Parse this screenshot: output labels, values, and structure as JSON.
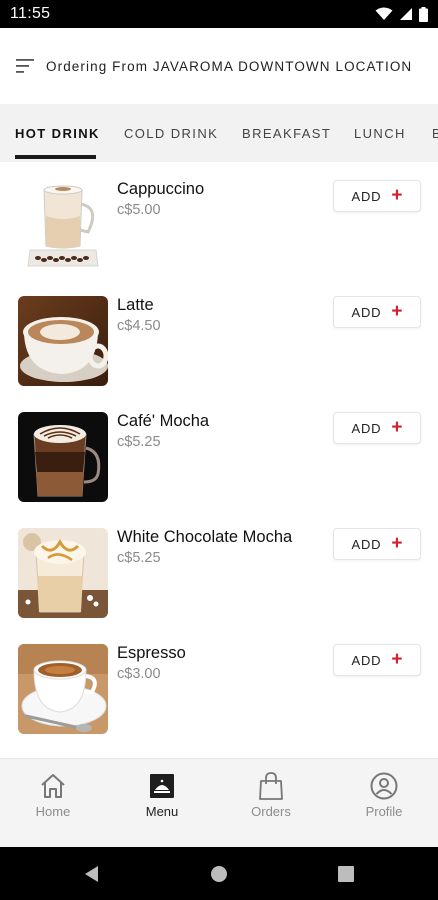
{
  "status_bar": {
    "time": "11:55",
    "icons": [
      "wifi-icon",
      "signal-icon",
      "battery-icon"
    ]
  },
  "header": {
    "title": "Ordering From JAVAROMA DOWNTOWN LOCATION",
    "menu_icon": "menu-lines-icon"
  },
  "tabs": [
    {
      "label": "HOT DRINK",
      "active": true
    },
    {
      "label": "COLD DRINK",
      "active": false
    },
    {
      "label": "BREAKFAST",
      "active": false
    },
    {
      "label": "LUNCH",
      "active": false
    },
    {
      "label": "B",
      "active": false
    }
  ],
  "items": [
    {
      "name": "Cappuccino",
      "price": "c$5.00",
      "add_label": "ADD",
      "plus": "+"
    },
    {
      "name": "Latte",
      "price": "c$4.50",
      "add_label": "ADD",
      "plus": "+"
    },
    {
      "name": "Café' Mocha",
      "price": "c$5.25",
      "add_label": "ADD",
      "plus": "+"
    },
    {
      "name": "White Chocolate Mocha",
      "price": "c$5.25",
      "add_label": "ADD",
      "plus": "+"
    },
    {
      "name": "Espresso",
      "price": "c$3.00",
      "add_label": "ADD",
      "plus": "+"
    }
  ],
  "bottom_nav": [
    {
      "label": "Home",
      "icon": "home-icon",
      "active": false
    },
    {
      "label": "Menu",
      "icon": "menu-tray-icon",
      "active": true
    },
    {
      "label": "Orders",
      "icon": "shopping-bag-icon",
      "active": false
    },
    {
      "label": "Profile",
      "icon": "profile-icon",
      "active": false
    }
  ],
  "colors": {
    "accent": "#d11f2c",
    "tab_bg": "#f2f2f3",
    "nav_bg": "#f4f4f5",
    "muted_text": "#8a8a8a"
  }
}
